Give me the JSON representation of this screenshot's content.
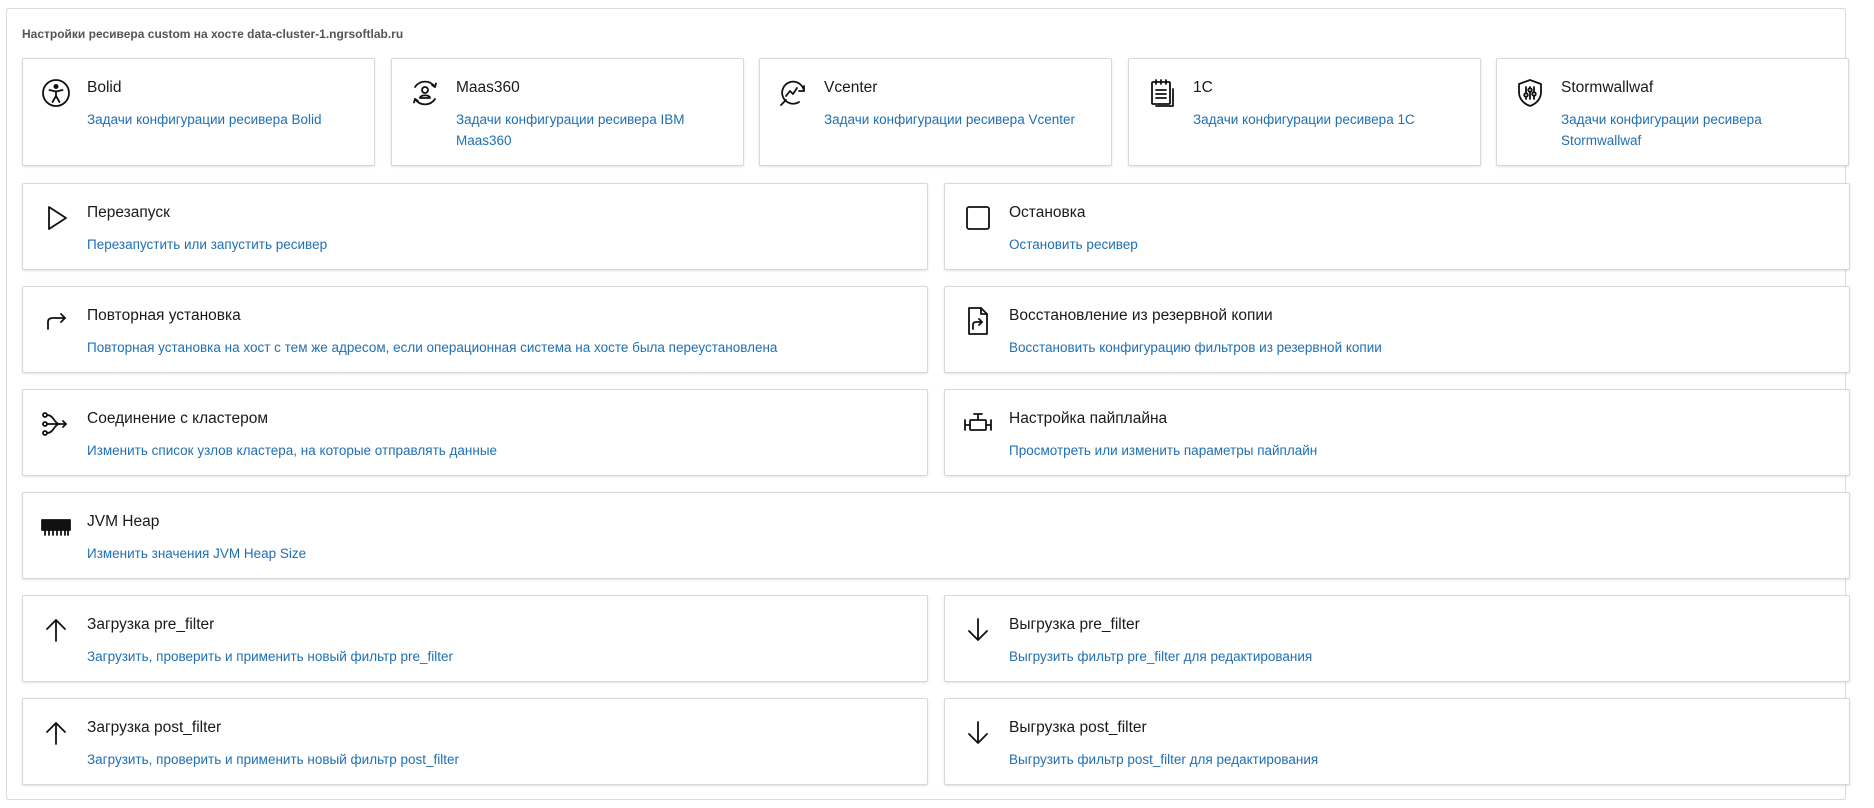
{
  "panel": {
    "title": "Настройки ресивера custom на хосте data-cluster-1.ngrsoftlab.ru"
  },
  "receivers": [
    {
      "title": "Bolid",
      "desc": "Задачи конфигурации ресивера Bolid",
      "icon": "accessibility-icon"
    },
    {
      "title": "Maas360",
      "desc": "Задачи конфигурации ресивера IBM Maas360",
      "icon": "user-circle-arrows-icon"
    },
    {
      "title": "Vcenter",
      "desc": "Задачи конфигурации ресивера Vcenter",
      "icon": "chart-refresh-icon"
    },
    {
      "title": "1C",
      "desc": "Задачи конфигурации ресивера 1C",
      "icon": "document-list-icon"
    },
    {
      "title": "Stormwallwaf",
      "desc": "Задачи конфигурации ресивера Stormwallwaf",
      "icon": "shield-sliders-icon"
    }
  ],
  "actions": {
    "restart": {
      "title": "Перезапуск",
      "desc": "Перезапустить или запустить ресивер",
      "icon": "play-icon"
    },
    "stop": {
      "title": "Остановка",
      "desc": "Остановить ресивер",
      "icon": "stop-icon"
    },
    "reinstall": {
      "title": "Повторная установка",
      "desc": "Повторная установка на хост с тем же адресом, если операционная система на хосте была переустановлена",
      "icon": "redo-arrow-icon"
    },
    "restore": {
      "title": "Восстановление из резервной копии",
      "desc": "Восстановить конфигурацию фильтров из резервной копии",
      "icon": "file-export-icon"
    },
    "cluster": {
      "title": "Соединение с кластером",
      "desc": "Изменить список узлов кластера, на которые отправлять данные",
      "icon": "connection-branch-icon"
    },
    "pipeline": {
      "title": "Настройка пайплайна",
      "desc": "Просмотреть или изменить параметры пайплайн",
      "icon": "pipeline-valve-icon"
    },
    "jvm": {
      "title": "JVM Heap",
      "desc": "Изменить значения JVM Heap Size",
      "icon": "memory-chip-icon"
    },
    "pre_upload": {
      "title": "Загрузка pre_filter",
      "desc": "Загрузить, проверить и применить новый фильтр pre_filter",
      "icon": "arrow-up-icon"
    },
    "pre_download": {
      "title": "Выгрузка pre_filter",
      "desc": "Выгрузить фильтр pre_filter для редактирования",
      "icon": "arrow-down-icon"
    },
    "post_upload": {
      "title": "Загрузка post_filter",
      "desc": "Загрузить, проверить и применить новый фильтр post_filter",
      "icon": "arrow-up-icon"
    },
    "post_download": {
      "title": "Выгрузка post_filter",
      "desc": "Выгрузить фильтр post_filter для редактирования",
      "icon": "arrow-down-icon"
    }
  },
  "colors": {
    "link": "#1f6fb3",
    "title": "#1a1a1a",
    "border": "#d8d8d8"
  }
}
